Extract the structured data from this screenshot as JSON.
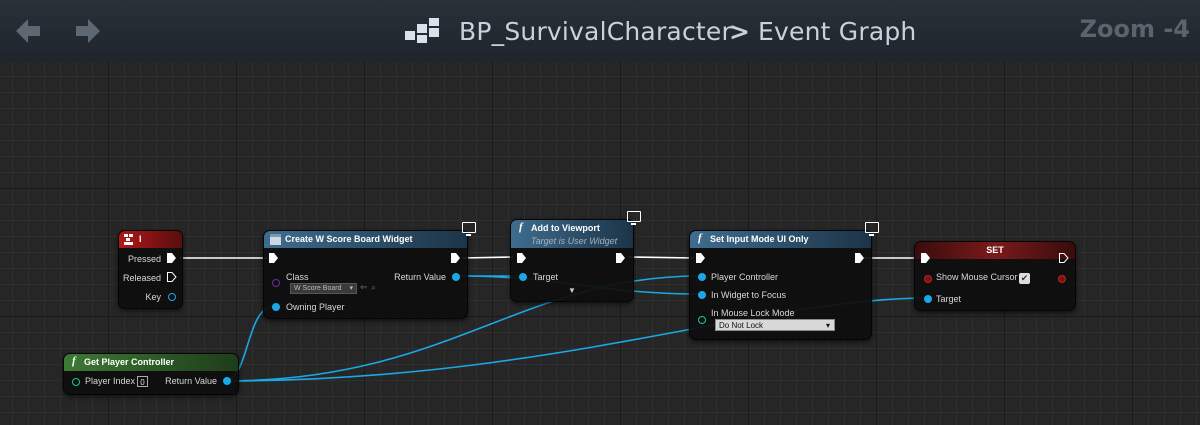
{
  "header": {
    "blueprint_name": "BP_SurvivalCharacter",
    "separator": ">",
    "graph_name": "Event Graph",
    "zoom": "Zoom -4",
    "back_icon": "arrow-left-icon",
    "forward_icon": "arrow-right-icon",
    "graph_icon": "blueprint-graph-icon"
  },
  "nodes": {
    "key_i": {
      "title": "I",
      "pins": {
        "pressed": "Pressed",
        "released": "Released",
        "key": "Key"
      }
    },
    "create_widget": {
      "title": "Create W Score Board Widget",
      "pins": {
        "class": "Class",
        "class_value": "W Score Board",
        "owning_player": "Owning Player",
        "return_value": "Return Value"
      }
    },
    "add_to_viewport": {
      "title": "Add to Viewport",
      "subtitle": "Target is User Widget",
      "pins": {
        "target": "Target"
      }
    },
    "set_input_mode": {
      "title": "Set Input Mode UI Only",
      "pins": {
        "player_controller": "Player Controller",
        "widget_to_focus": "In Widget to Focus",
        "mouse_lock_mode": "In Mouse Lock Mode",
        "mouse_lock_value": "Do Not Lock"
      }
    },
    "set_node": {
      "title": "SET",
      "pins": {
        "show_mouse_cursor": "Show Mouse Cursor",
        "show_mouse_cursor_checked": true,
        "target": "Target"
      }
    },
    "get_player_controller": {
      "title": "Get Player Controller",
      "pins": {
        "player_index": "Player Index",
        "player_index_value": "0",
        "return_value": "Return Value"
      }
    }
  },
  "colors": {
    "exec_wire": "#ffffff",
    "object_wire": "#1aa8e6",
    "event_header": "#8c1414",
    "function_header": "#2c4c6c",
    "pure_header": "#2f5a2a",
    "set_header": "#5a1414"
  }
}
